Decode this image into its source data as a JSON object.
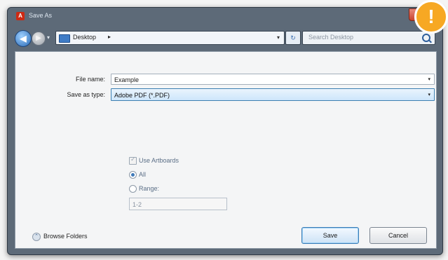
{
  "window": {
    "title": "Save As",
    "close_glyph": "✕"
  },
  "toolbar": {
    "back_glyph": "◀",
    "forward_glyph": "▶",
    "location": "Desktop",
    "location_separator": "▸",
    "dropdown_glyph": "▾",
    "search_placeholder": "Search Desktop"
  },
  "form": {
    "file_name_label": "File name:",
    "file_name_value": "Example",
    "save_type_label": "Save as type:",
    "save_type_value": "Adobe PDF (*.PDF)"
  },
  "options": {
    "use_artboards_label": "Use Artboards",
    "use_artboards_checked": true,
    "all_label": "All",
    "range_label": "Range:",
    "range_value": "1-2",
    "selected": "all"
  },
  "footer": {
    "browse_folders_label": "Browse Folders",
    "save_label": "Save",
    "cancel_label": "Cancel"
  },
  "colors": {
    "titlebar": "#5d6a78",
    "accent": "#3b7cb5",
    "close": "#c8432d",
    "badge": "#f7a823"
  },
  "icons": {
    "app": "adobe-app-icon",
    "back": "back-arrow-icon",
    "forward": "forward-arrow-icon",
    "folder": "desktop-folder-icon",
    "refresh": "refresh-icon",
    "search": "search-icon",
    "browse": "chevron-circle-icon",
    "badge": "exclamation-icon"
  },
  "badge": {
    "glyph": "!"
  }
}
